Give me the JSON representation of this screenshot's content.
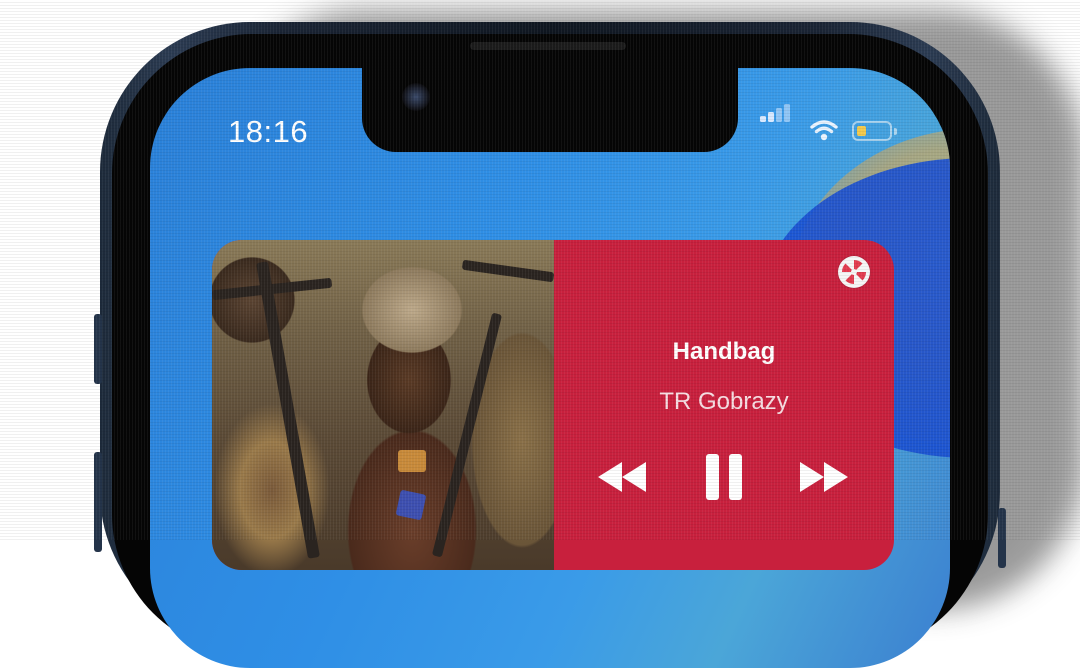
{
  "status_bar": {
    "time": "18:16",
    "signal_icon": "cellular-signal-icon",
    "wifi_icon": "wifi-icon",
    "battery_icon": "battery-low-icon",
    "battery_level": 0.3
  },
  "now_playing_widget": {
    "track_title": "Handbag",
    "artist": "TR Gobrazy",
    "app_icon": "music-app-icon",
    "controls": {
      "previous": "backward-icon",
      "pause": "pause-icon",
      "next": "forward-icon"
    },
    "colors": {
      "accent": "#c8203d",
      "text": "#ffffff"
    }
  }
}
